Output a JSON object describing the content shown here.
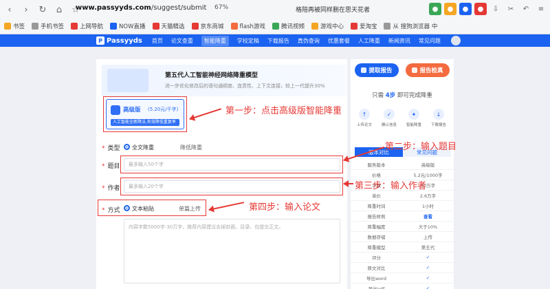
{
  "browser": {
    "url_domain": "www.passyyds.com",
    "url_path": "/suggest/submit",
    "zoom": "67%",
    "tab_title": "格陪再被同样删在思天花者"
  },
  "bookmarks": [
    "书签",
    "手机书签",
    "上网导航",
    "NOW直播",
    "天猫精选",
    "京东商城",
    "flash游戏",
    "腾讯视频",
    "游戏中心",
    "爱淘宝",
    "从 搜狗浏览器 中"
  ],
  "site_nav": {
    "logo": "Passyyds",
    "items": [
      "首页",
      "论文查重",
      "智能降重",
      "学校定稿",
      "下载报告",
      "真伪查询",
      "优惠套餐",
      "人工降重",
      "新闻资讯",
      "常见问题"
    ]
  },
  "banner": {
    "title": "第五代人工智能神经网络降重模型",
    "subtitle": "进一步优化修改后的语句通顺度、连贯性、上下文连接，较上一代提升30%"
  },
  "card": {
    "title": "高级版",
    "price": "(5.20元/千字)",
    "desc": "人工智能全新降法,有效降低重复率"
  },
  "form": {
    "type_label": "类型",
    "type_opt1": "全文降重",
    "type_opt2": "降低降重",
    "title_label": "题目",
    "title_placeholder": "最多输入50个字",
    "author_label": "作者",
    "author_placeholder": "最多输入20个字",
    "method_label": "方式",
    "method_opt1": "文本粘贴",
    "method_opt2": "单篇上传",
    "content_placeholder": "内容字数5000字-30万字，推荐内容建议去掉封面、目录、仅提交正文。"
  },
  "side": {
    "btn_get": "提取报告",
    "btn_check": "报告检真",
    "steps_caption_pre": "只需",
    "steps_caption_hl": "4步",
    "steps_caption_post": "即可完成降重",
    "steps": [
      "上传论文",
      "确认信息",
      "智能降重",
      "下载报告"
    ],
    "tabs": [
      "版本对比",
      "常见问题"
    ],
    "table_rows": [
      [
        "服务版本",
        "高级版"
      ],
      [
        "价格",
        "5.2元/1000字"
      ],
      [
        "字数",
        "30万字"
      ],
      [
        "单价",
        "2.6万字"
      ],
      [
        "降重时间",
        "1小时"
      ],
      [
        "报告样例",
        "查看"
      ],
      [
        "降重幅度",
        "大于10%"
      ],
      [
        "数据存储",
        "上传"
      ],
      [
        "降重模型",
        "第五代"
      ],
      [
        "评分",
        "✓"
      ],
      [
        "原文对比",
        "✓"
      ],
      [
        "导出word",
        "✓"
      ],
      [
        "导出pdf",
        "✓"
      ]
    ]
  },
  "annotations": {
    "step1": "第一步：点击高级版智能降重",
    "step2": "第二步：输入题目",
    "step3": "第三步：输入作者",
    "step4": "第四步：输入论文"
  },
  "colors": {
    "primary": "#1b63f0",
    "annotation": "#e53935",
    "accent_orange": "#f36b3f"
  }
}
